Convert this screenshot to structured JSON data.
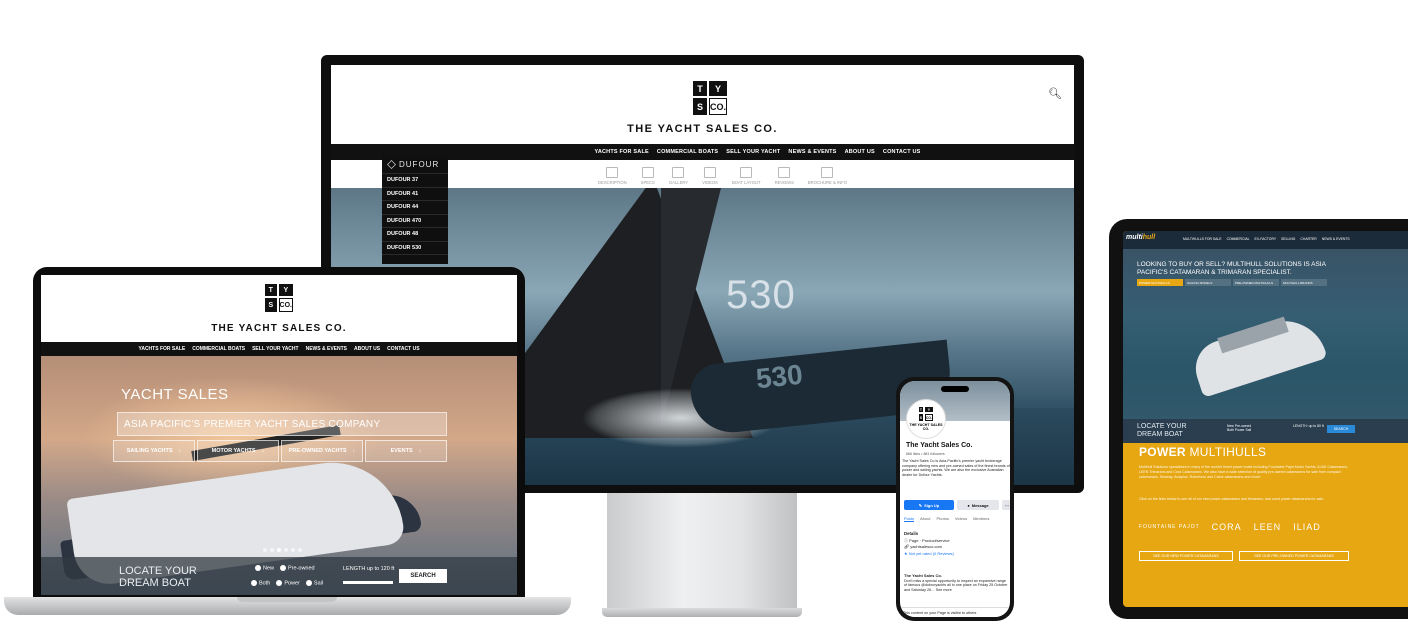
{
  "brand": {
    "name": "THE YACHT SALES CO.",
    "logo_letters": [
      "T",
      "Y",
      "S",
      "CO."
    ]
  },
  "monitor": {
    "nav": [
      "YACHTS FOR SALE",
      "COMMERCIAL BOATS",
      "SELL YOUR YACHT",
      "NEWS & EVENTS",
      "ABOUT US",
      "CONTACT US"
    ],
    "tabs": [
      "DESCRIPTION",
      "SPECS",
      "GALLERY",
      "VIDEOS",
      "BOAT LAYOUT",
      "REVIEWS",
      "BROCHURE & INFO"
    ],
    "dufour_brand": "DUFOUR",
    "dufour_models": [
      "DUFOUR 37",
      "DUFOUR 41",
      "DUFOUR 44",
      "DUFOUR 470",
      "DUFOUR 48",
      "DUFOUR 530"
    ],
    "sail_number": "530",
    "hull_number": "530"
  },
  "laptop": {
    "nav": [
      "YACHTS FOR SALE",
      "COMMERCIAL BOATS",
      "SELL YOUR YACHT",
      "NEWS & EVENTS",
      "ABOUT US",
      "CONTACT US"
    ],
    "hero_title": "YACHT SALES",
    "hero_subtitle": "ASIA PACIFIC'S PREMIER YACHT SALES COMPANY",
    "hero_buttons": [
      "SAILING YACHTS",
      "MOTOR YACHTS",
      "PRE-OWNED YACHTS",
      "EVENTS"
    ],
    "locate_line1": "LOCATE YOUR",
    "locate_line2": "DREAM BOAT",
    "radio_row1": [
      "New",
      "Pre-owned"
    ],
    "radio_row2": [
      "Both",
      "Power",
      "Sail"
    ],
    "length_label": "LENGTH",
    "length_value": "up to 120 ft",
    "search_button": "SEARCH"
  },
  "tablet": {
    "logo_a": "multi",
    "logo_b": "hull",
    "nav": [
      "MULTIHULLS FOR SALE",
      "COMMERCIAL",
      "EX-FACTORY",
      "SELLING",
      "CHARTER",
      "NEWS & EVENTS"
    ],
    "hero_text": "LOOKING TO BUY OR SELL? MULTIHULL SOLUTIONS IS ASIA PACIFIC'S CATAMARAN & TRIMARAN SPECIALIST.",
    "filters": [
      "POWER MULTIHULLS",
      "SAILING MODELS",
      "PRE-OWNED MULTIHULLS",
      "MULTIHULL BRANDS"
    ],
    "locate_line1": "LOCATE YOUR",
    "locate_line2": "DREAM BOAT",
    "radios_row1": "New  Pre-owned",
    "radios_row2": "Both  Power  Sail",
    "length_label": "LENGTH: up to 80 ft",
    "search_button": "SEARCH",
    "power_bold": "POWER",
    "power_rest": " MULTIHULLS",
    "paragraph1": "Multihull Solutions specialises in many of the world's finest power boats including Fountaine Pajot Motor Yachts, ILIAD Catamarans, LEEN Trimarans and Cora Catamarans. We also have a wide selection of quality pre-owned catamarans for sale from compact catamarans, Seaway, Aviaplus, Robertson and Caine catamarans and more!",
    "paragraph2": "Click on the links below to see all of our new power catamarans and trimarans, and used power catamarans for sale.",
    "brands": [
      "FOUNTAINE PAJOT",
      "CORA",
      "LEEN",
      "ILIAD"
    ],
    "cta1": "SEE OUR NEW POWER CATAMARANS",
    "cta2": "SEE OUR PRE-OWNED POWER CATAMARANS"
  },
  "phone": {
    "avatar_name": "THE YACHT SALES CO.",
    "page_name": "The Yacht Sales Co.",
    "stats": "666 likes • 881 followers",
    "bio": "The Yacht Sales Co is Asia-Pacific's premier yacht brokerage company offering new and pre-owned sales of the finest brands of power and sailing yachts. We are also the exclusive Australian dealer for Dufour Yachts.",
    "signup": "Sign Up",
    "message": "Message",
    "more": "···",
    "tabs": [
      "Posts",
      "About",
      "Photos",
      "Videos",
      "Mentions"
    ],
    "details_heading": "Details",
    "detail_page": "Page · Product/service",
    "detail_url": "yachtsalesco.com",
    "detail_rating": "Not yet rated (0 Reviews)",
    "post_author": "The Yacht Sales Co.",
    "post_text": "Don't miss a special opportunity to inspect an expansive range of famous @dufouryachts all in one place on Friday 25 October and Saturday 26… See more",
    "banner": "This content on your Page is visible to others"
  }
}
